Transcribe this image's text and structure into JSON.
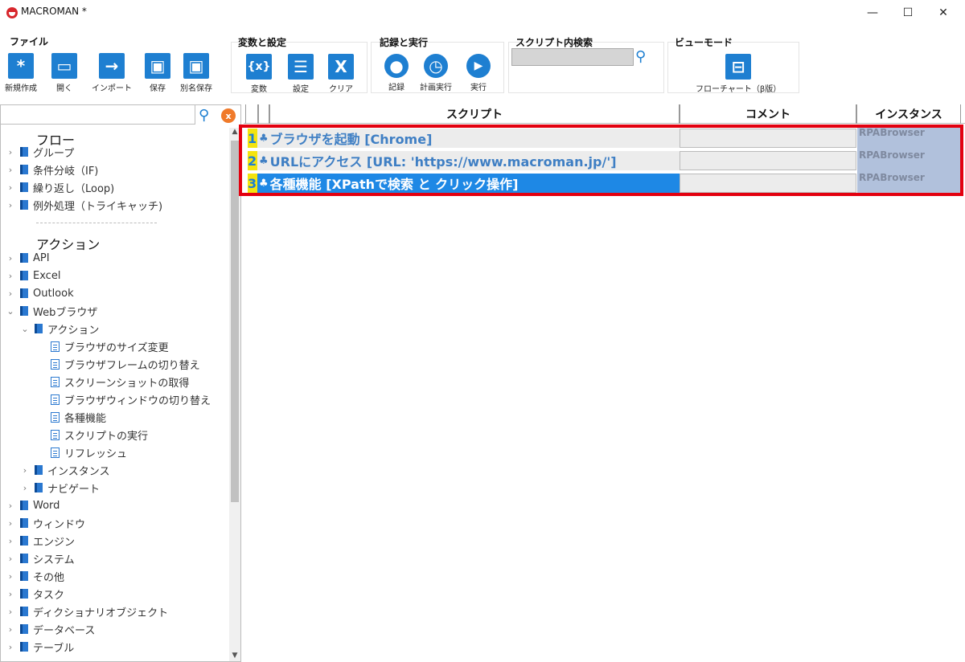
{
  "window": {
    "title": "MACROMAN *",
    "min": "—",
    "max": "☐",
    "close": "✕"
  },
  "ribbon": {
    "file": {
      "title": "ファイル",
      "buttons": [
        {
          "label": "新規作成",
          "glyph": "*"
        },
        {
          "label": "開く",
          "glyph": "▭"
        },
        {
          "label": "インポート",
          "glyph": "→"
        },
        {
          "label": "保存",
          "glyph": "▣"
        },
        {
          "label": "別名保存",
          "glyph": "▣"
        }
      ]
    },
    "vars": {
      "title": "変数と設定",
      "buttons": [
        {
          "label": "変数",
          "glyph": "{x}"
        },
        {
          "label": "設定",
          "glyph": "☰"
        },
        {
          "label": "クリア",
          "glyph": "X"
        }
      ]
    },
    "record": {
      "title": "記録と実行",
      "buttons": [
        {
          "label": "記録",
          "glyph": "●"
        },
        {
          "label": "計画実行",
          "glyph": "◷"
        },
        {
          "label": "実行",
          "glyph": "▶"
        }
      ]
    },
    "search": {
      "title": "スクリプト内検索",
      "value": ""
    },
    "view": {
      "title": "ビューモード",
      "buttons": [
        {
          "label": "フローチャート（β版）",
          "glyph": "⊟"
        }
      ]
    }
  },
  "tree": {
    "flow_header": "フロー",
    "flow_items": [
      "グループ",
      "条件分岐（IF)",
      "繰り返し（Loop)",
      "例外処理（トライキャッチ)"
    ],
    "action_header": "アクション",
    "action_items": [
      "API",
      "Excel",
      "Outlook",
      "Webブラウザ"
    ],
    "web_sub": "アクション",
    "web_actions": [
      "ブラウザのサイズ変更",
      "ブラウザフレームの切り替え",
      "スクリーンショットの取得",
      "ブラウザウィンドウの切り替え",
      "各種機能",
      "スクリプトの実行",
      "リフレッシュ"
    ],
    "web_more": [
      "インスタンス",
      "ナビゲート"
    ],
    "rest_items": [
      "Word",
      "ウィンドウ",
      "エンジン",
      "システム",
      "その他",
      "タスク",
      "ディクショナリオブジェクト",
      "データベース",
      "テーブル"
    ]
  },
  "grid": {
    "headers": {
      "script": "スクリプト",
      "comment": "コメント",
      "instance": "インスタンス"
    },
    "rows": [
      {
        "num": "1",
        "script": "ブラウザを起動 [Chrome]",
        "comment": "",
        "instance": "RPABrowser"
      },
      {
        "num": "2",
        "script": "URLにアクセス [URL: 'https://www.macroman.jp/']",
        "comment": "",
        "instance": "RPABrowser"
      },
      {
        "num": "3",
        "script": "各種機能 [XPathで検索 と クリック操作]",
        "comment": "",
        "instance": "RPABrowser"
      }
    ]
  },
  "colors": {
    "accent": "#1e7fd1",
    "selection": "#1e88e5",
    "highlight": "#e3000f"
  }
}
